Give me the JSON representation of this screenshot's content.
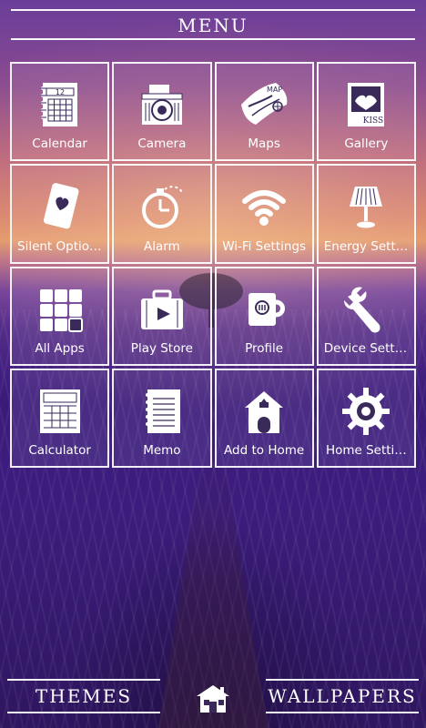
{
  "header": {
    "title": "MENU"
  },
  "tiles": [
    {
      "label": "Calendar",
      "icon": "calendar-icon"
    },
    {
      "label": "Camera",
      "icon": "camera-icon"
    },
    {
      "label": "Maps",
      "icon": "map-icon"
    },
    {
      "label": "Gallery",
      "icon": "photo-icon"
    },
    {
      "label": "Silent Options",
      "icon": "card-heart-icon"
    },
    {
      "label": "Alarm",
      "icon": "stopwatch-icon"
    },
    {
      "label": "Wi-Fi Settings",
      "icon": "wifi-icon"
    },
    {
      "label": "Energy Setti…",
      "icon": "lamp-icon"
    },
    {
      "label": "All Apps",
      "icon": "apps-grid-icon"
    },
    {
      "label": "Play Store",
      "icon": "suitcase-play-icon"
    },
    {
      "label": "Profile",
      "icon": "mug-icon"
    },
    {
      "label": "Device Setti…",
      "icon": "wrench-icon"
    },
    {
      "label": "Calculator",
      "icon": "calculator-icon"
    },
    {
      "label": "Memo",
      "icon": "notebook-icon"
    },
    {
      "label": "Add to Home",
      "icon": "house-icon"
    },
    {
      "label": "Home Setti…",
      "icon": "gear-icon"
    }
  ],
  "footer": {
    "themes": "THEMES",
    "wallpapers": "WALLPAPERS",
    "home_icon": "cabin-icon"
  }
}
